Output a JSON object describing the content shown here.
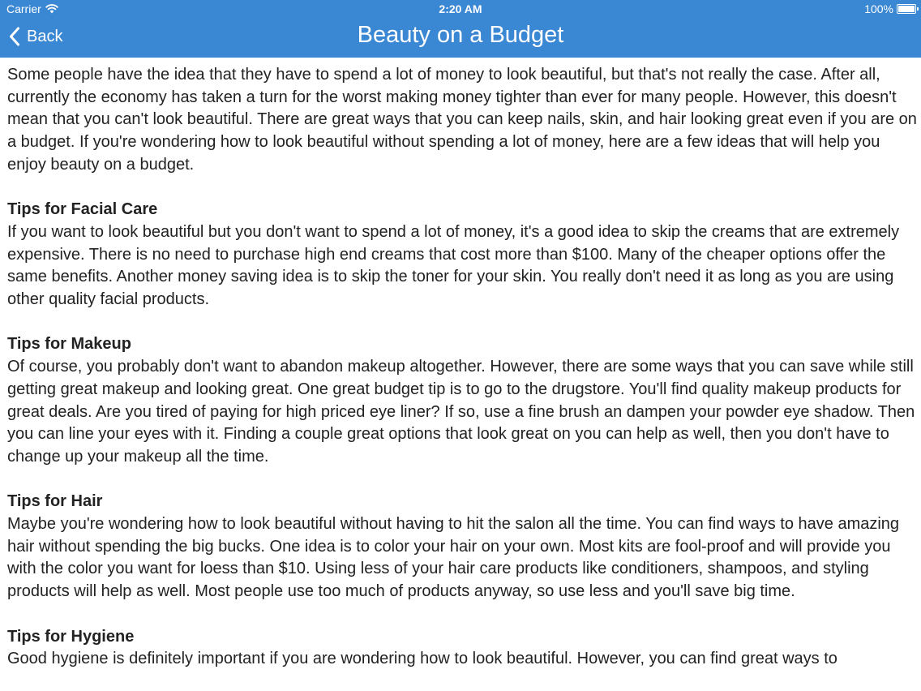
{
  "status_bar": {
    "carrier": "Carrier",
    "time": "2:20 AM",
    "battery": "100%",
    "icons": [
      "wifi-icon",
      "battery-icon"
    ]
  },
  "nav": {
    "back_label": "Back",
    "title": "Beauty on a Budget",
    "back_icon": "chevron-left-icon"
  },
  "colors": {
    "header_bg": "#3a87d3",
    "header_text": "#ffffff",
    "body_text": "#222222",
    "background": "#ffffff"
  },
  "article": {
    "intro": "Some people have the idea that they have to spend a lot of money to look beautiful, but that's not really the case. After all, currently the economy has taken a turn for the worst making money tighter than ever for many people. However, this doesn't mean that you can't look beautiful. There are great ways that you can keep nails, skin, and hair looking great even if you are on a budget. If you're wondering how to look beautiful without spending a lot of money, here are a few ideas that will help you enjoy beauty on a budget.",
    "sections": [
      {
        "heading": "Tips for Facial Care",
        "body": "If you want to look beautiful but you don't want to spend a lot of money, it's a good idea to skip the creams that are extremely expensive. There is no need to purchase high end creams that cost more than $100. Many of the cheaper options offer the same benefits. Another money saving idea is to skip the toner for your skin. You really don't need it as long as you are using other quality facial products."
      },
      {
        "heading": "Tips for Makeup",
        "body": "Of course, you probably don't want to abandon makeup altogether. However, there are some ways that you can save while still getting great makeup and looking great. One great budget tip is to go to the drugstore. You'll find quality makeup products for great deals. Are you tired of paying for high priced eye liner? If so, use a fine brush an dampen your powder eye shadow. Then you can line your eyes with it. Finding a couple great options that look great on you can help as well, then you don't have to change up your makeup all the time."
      },
      {
        "heading": "Tips for Hair",
        "body": "Maybe you're wondering how to look beautiful without having to hit the salon all the time. You can find ways to have amazing hair without spending the big bucks. One idea is to color your hair on your own. Most kits are fool-proof and will provide you with the color you want for loess than $10. Using less of your hair care products like conditioners, shampoos, and styling products will help as well. Most people use too much of products anyway, so use less and you'll save big time."
      },
      {
        "heading": "Tips for Hygiene",
        "body": "Good hygiene is definitely important if you are wondering how to look beautiful. However, you can find great ways to"
      }
    ]
  }
}
